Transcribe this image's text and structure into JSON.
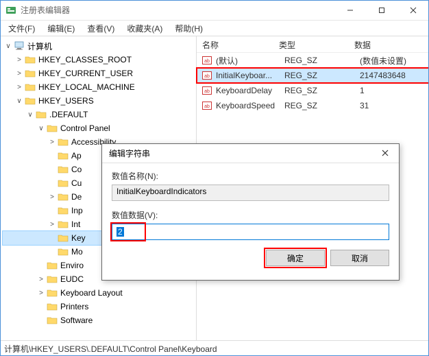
{
  "window": {
    "title": "注册表编辑器"
  },
  "menu": {
    "file": "文件(F)",
    "edit": "编辑(E)",
    "view": "查看(V)",
    "favorites": "收藏夹(A)",
    "help": "帮助(H)"
  },
  "tree": {
    "root": "计算机",
    "hkcr": "HKEY_CLASSES_ROOT",
    "hkcu": "HKEY_CURRENT_USER",
    "hklm": "HKEY_LOCAL_MACHINE",
    "hku": "HKEY_USERS",
    "default": ".DEFAULT",
    "cp": "Control Panel",
    "cp_items": [
      "Accessibility",
      "Appearance",
      "Colors",
      "Cursors",
      "Desktop",
      "Input Method",
      "International",
      "Keyboard",
      "Mouse"
    ],
    "cp_items_display": [
      "Accessibility",
      "Ap",
      "Co",
      "Cu",
      "De",
      "Inp",
      "Int",
      "Key",
      "Mo"
    ],
    "siblings": [
      "Environment",
      "EUDC",
      "Keyboard Layout",
      "Printers",
      "Software"
    ],
    "siblings_display": [
      "Enviro",
      "EUDC",
      "Keyboard Layout",
      "Printers",
      "Software"
    ]
  },
  "list": {
    "cols": {
      "name": "名称",
      "type": "类型",
      "data": "数据"
    },
    "rows": [
      {
        "name": "(默认)",
        "type": "REG_SZ",
        "data": "(数值未设置)",
        "sel": false
      },
      {
        "name": "InitialKeyboar...",
        "type": "REG_SZ",
        "data": "2147483648",
        "sel": true
      },
      {
        "name": "KeyboardDelay",
        "type": "REG_SZ",
        "data": "1",
        "sel": false
      },
      {
        "name": "KeyboardSpeed",
        "type": "REG_SZ",
        "data": "31",
        "sel": false
      }
    ]
  },
  "status": {
    "path": "计算机\\HKEY_USERS\\.DEFAULT\\Control Panel\\Keyboard"
  },
  "dialog": {
    "title": "编辑字符串",
    "name_label": "数值名称(N):",
    "name_value": "InitialKeyboardIndicators",
    "data_label": "数值数据(V):",
    "data_value": "2",
    "ok": "确定",
    "cancel": "取消"
  }
}
